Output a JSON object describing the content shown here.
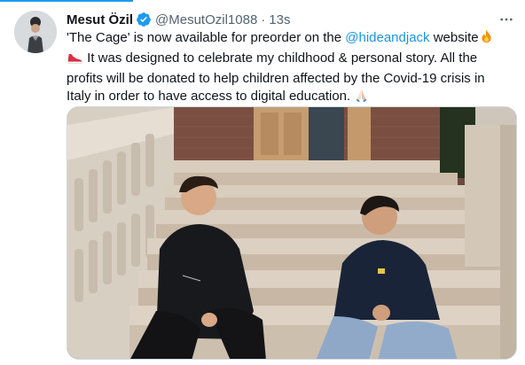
{
  "tweet": {
    "author_name": "Mesut Özil",
    "handle": "@MesutOzil1088",
    "separator": "·",
    "time": "13s",
    "more_label": "···",
    "text_part1": "'The Cage' is now available for preorder on the ",
    "mention": "@hideandjack",
    "text_part2": " website",
    "text_part3": " It was designed to celebrate my childhood & personal story. All the profits will be donated to help children affected by the Covid-19 crisis in Italy in order to have access to digital education. ",
    "emojis": [
      "fire-emoji",
      "sneaker-emoji",
      "folded-hands-emoji"
    ]
  },
  "colors": {
    "accent": "#1d9bf0",
    "link": "#1b95e0",
    "secondary_text": "#536471",
    "primary_text": "#0f1419"
  }
}
